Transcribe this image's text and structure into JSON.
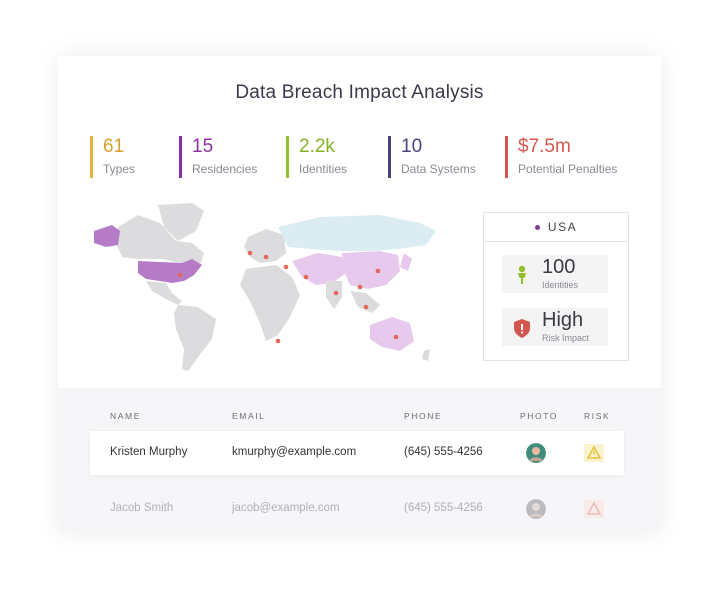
{
  "title": "Data Breach Impact Analysis",
  "stats": [
    {
      "value": "61",
      "label": "Types",
      "color": "#e2b33b"
    },
    {
      "value": "15",
      "label": "Residencies",
      "color": "#8a2fa0"
    },
    {
      "value": "2.2k",
      "label": "Identities",
      "color": "#93bf2e"
    },
    {
      "value": "10",
      "label": "Data Systems",
      "color": "#47427e"
    },
    {
      "value": "$7.5m",
      "label": "Potential Penalties",
      "color": "#d2584f"
    }
  ],
  "country": {
    "name": "USA",
    "identities_value": "100",
    "identities_label": "Identities",
    "risk_value": "High",
    "risk_label": "Risk Impact"
  },
  "table": {
    "headers": [
      "NAME",
      "EMAIL",
      "PHONE",
      "PHOTO",
      "RISK"
    ],
    "rows": [
      {
        "name": "Kristen Murphy",
        "email": "kmurphy@example.com",
        "phone": "(645) 555-4256"
      },
      {
        "name": "Jacob Smith",
        "email": "jacob@example.com",
        "phone": "(645) 555-4256"
      }
    ]
  },
  "colors": {
    "accent_purple": "#8a2fa0",
    "map_highlight": "#c98fd6",
    "map_light": "#e8c9ee",
    "map_teal": "#dbedf2",
    "map_grey": "#dcdcdf",
    "marker": "#e2685a",
    "warning": "#e9c23a"
  },
  "icons": [
    "map-marker-icon",
    "identity-person-icon",
    "risk-shield-icon",
    "warning-triangle-icon"
  ]
}
